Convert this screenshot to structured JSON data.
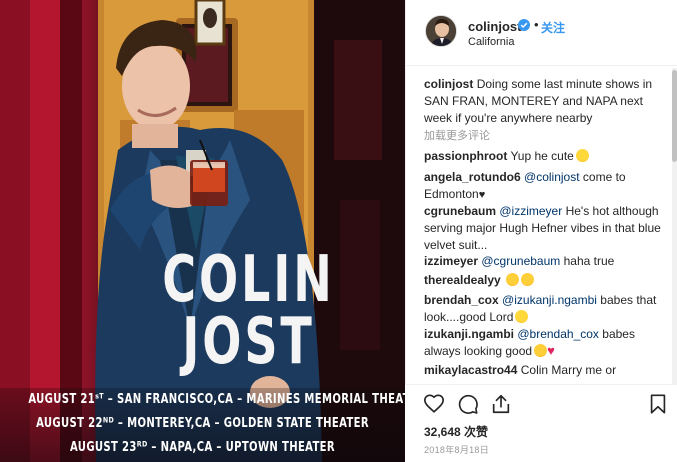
{
  "post": {
    "username": "colinjost",
    "verified": true,
    "separator": "•",
    "follow_label": "关注",
    "location": "California",
    "caption_user": "colinjost",
    "caption_text": "Doing some last minute shows in SAN FRAN, MONTEREY and NAPA next week if you're anywhere nearby",
    "translate_label": "加载更多评论",
    "likes": "32,648 次赞",
    "timestamp": "2018年8月18日"
  },
  "poster": {
    "name_first": "COLIN",
    "name_last": "JOST",
    "dates": [
      {
        "date": "AUGUST 21ˢᵀ",
        "text": "– SAN FRANCISCO,CA – MARINES MEMORIAL THEATER"
      },
      {
        "date": "AUGUST 22ᴺᴰ",
        "text": "– MONTEREY,CA – GOLDEN STATE THEATER"
      },
      {
        "date": "AUGUST 23ᴿᴰ",
        "text": "– NAPA,CA – UPTOWN THEATER"
      }
    ]
  },
  "comments": [
    {
      "user": "passionphroot",
      "text": "Yup he cute",
      "emoji": "grinning-face"
    },
    {
      "user": "angela_rotundo6",
      "mention": "@colinjost",
      "text": "come to Edmonton",
      "emoji": "black-heart"
    },
    {
      "user": "cgrunebaum",
      "mention": "@izzimeyer",
      "text": "He's hot although serving major Hugh Hefner vibes in that blue velvet suit..."
    },
    {
      "user": "izzimeyer",
      "mention": "@cgrunebaum",
      "text": "haha true"
    },
    {
      "user": "therealdealyy",
      "text": "",
      "emoji": "heart-eyes-x2"
    },
    {
      "user": "brendah_cox",
      "mention": "@izukanji.ngambi",
      "text": "babes that look....good Lord",
      "emoji": "drooling-face"
    },
    {
      "user": "izukanji.ngambi",
      "mention": "@brendah_cox",
      "text": "babes always looking good",
      "emoji": "heart-eyes-and-heart"
    },
    {
      "user": "mikaylacastro44",
      "text": "Colin Marry me or"
    }
  ],
  "icons": {
    "like": "heart-outline-icon",
    "comment": "comment-bubble-icon",
    "share": "share-upload-icon",
    "save": "bookmark-icon",
    "verified": "verified-badge-icon"
  },
  "colors": {
    "link": "#003569",
    "follow": "#3897f0",
    "muted": "#999999",
    "verified": "#3897f0"
  }
}
